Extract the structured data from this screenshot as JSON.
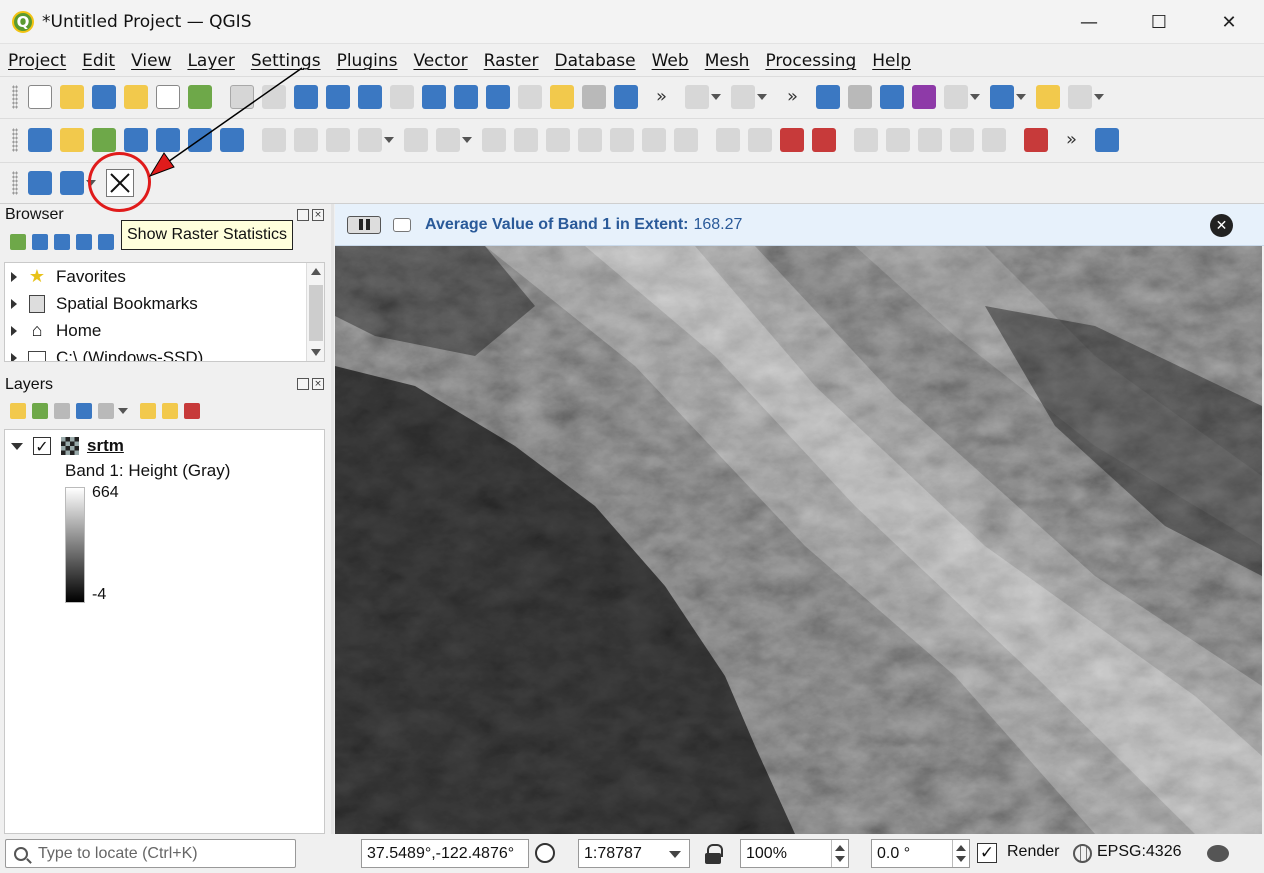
{
  "window": {
    "title": "*Untitled Project — QGIS",
    "minimize_glyph": "—",
    "maximize_glyph": "☐",
    "close_glyph": "✕"
  },
  "menu": [
    "Project",
    "Edit",
    "View",
    "Layer",
    "Settings",
    "Plugins",
    "Vector",
    "Raster",
    "Database",
    "Web",
    "Mesh",
    "Processing",
    "Help"
  ],
  "toolbar": {
    "overflow_glyph": "»",
    "show_raster_statistics_tooltip": "Show Raster Statistics"
  },
  "browser": {
    "title": "Browser",
    "items": [
      {
        "label": "Favorites",
        "icon": "star-icon"
      },
      {
        "label": "Spatial Bookmarks",
        "icon": "bookmark-icon"
      },
      {
        "label": "Home",
        "icon": "home-icon"
      },
      {
        "label": "C:\\ (Windows-SSD)",
        "icon": "drive-icon"
      }
    ]
  },
  "layers": {
    "title": "Layers",
    "layer_name": "srtm",
    "checked": true,
    "band_label": "Band 1: Height (Gray)",
    "ramp_max": "664",
    "ramp_min": "-4"
  },
  "message": {
    "title": "Average Value of Band 1 in Extent:",
    "value": "168.27"
  },
  "status": {
    "locator_placeholder": "Type to locate (Ctrl+K)",
    "coordinate": "37.5489°,-122.4876°",
    "scale": "1:78787",
    "magnifier": "100%",
    "rotation": "0.0 °",
    "render_label": "Render",
    "render_checked": true,
    "crs": "EPSG:4326"
  },
  "colors": {
    "message_text": "#2a5a99",
    "message_bg": "#e7f1fb",
    "highlight_circle": "#e01b1b"
  }
}
